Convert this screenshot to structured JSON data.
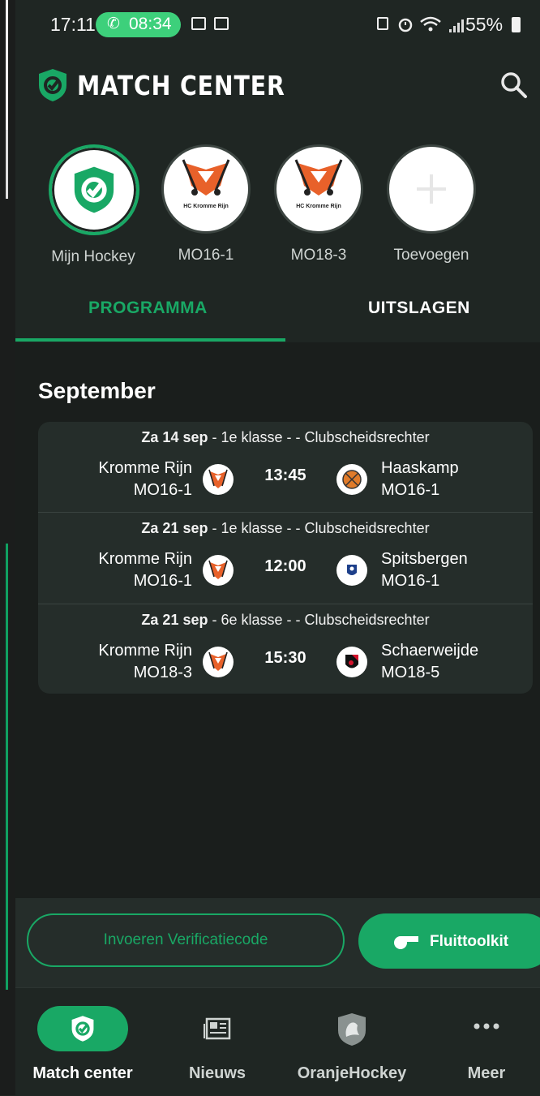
{
  "status_bar": {
    "time": "17:11",
    "call_timer": "08:34",
    "battery": "55%"
  },
  "header": {
    "title": "MATCH CENTER"
  },
  "teams": [
    {
      "label": "Mijn Hockey",
      "icon": "match-center-logo"
    },
    {
      "label": "MO16-1",
      "icon": "hc-kromme-rijn-crest",
      "crest_text": "HC Kromme Rijn"
    },
    {
      "label": "MO18-3",
      "icon": "hc-kromme-rijn-crest",
      "crest_text": "HC Kromme Rijn"
    },
    {
      "label": "Toevoegen",
      "icon": "plus-icon"
    }
  ],
  "tabs": {
    "programma": "PROGRAMMA",
    "uitslagen": "UITSLAGEN"
  },
  "month": "September",
  "matches": [
    {
      "date": "Za 14 sep",
      "info": " - 1e klasse -  - Clubscheidsrechter",
      "home_team": "Kromme Rijn",
      "home_sub": "MO16-1",
      "time": "13:45",
      "away_team": "Haaskamp",
      "away_sub": "MO16-1"
    },
    {
      "date": "Za 21 sep",
      "info": " - 1e klasse -  - Clubscheidsrechter",
      "home_team": "Kromme Rijn",
      "home_sub": "MO16-1",
      "time": "12:00",
      "away_team": "Spitsbergen",
      "away_sub": "MO16-1"
    },
    {
      "date": "Za 21 sep",
      "info": " - 6e klasse -  - Clubscheidsrechter",
      "home_team": "Kromme Rijn",
      "home_sub": "MO18-3",
      "time": "15:30",
      "away_team": "Schaerweijde",
      "away_sub": "MO18-5"
    }
  ],
  "actions": {
    "verify": "Invoeren Verificatiecode",
    "fluittoolkit": "Fluittoolkit"
  },
  "nav": {
    "match_center": "Match center",
    "nieuws": "Nieuws",
    "oranjehockey": "OranjeHockey",
    "meer": "Meer"
  },
  "colors": {
    "accent": "#19a865",
    "background": "#1f2623",
    "card": "#252d2a",
    "crest_orange": "#e8612a"
  }
}
